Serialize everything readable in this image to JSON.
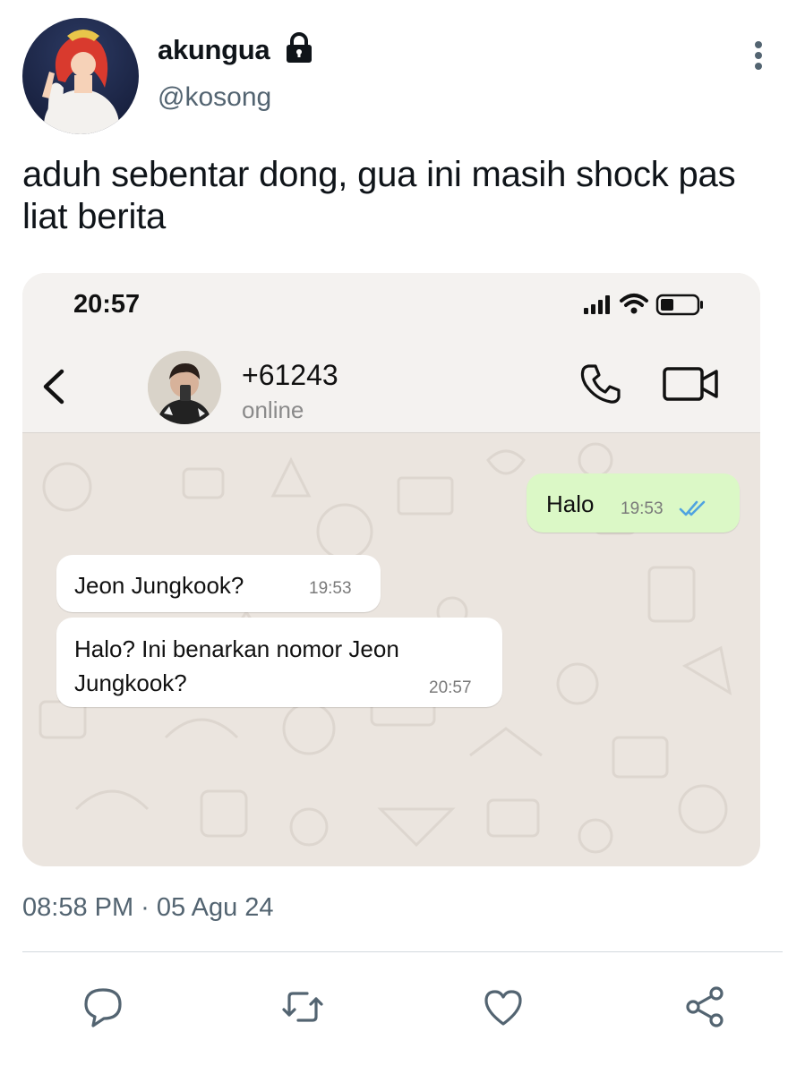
{
  "tweet": {
    "display_name": "akungua",
    "handle": "@kosong",
    "text": "aduh sebentar dong, gua ini masih shock pas liat berita",
    "timestamp": "08:58 PM · 05 Agu 24"
  },
  "chat": {
    "status_time": "20:57",
    "contact_number": "+61243",
    "contact_status": "online",
    "messages": [
      {
        "direction": "outgoing",
        "text": "Halo",
        "time": "19:53"
      },
      {
        "direction": "incoming",
        "text": "Jeon Jungkook?",
        "time": "19:53"
      },
      {
        "direction": "incoming",
        "text_lines": [
          "Halo? Ini benarkan nomor Jeon",
          "Jungkook?"
        ],
        "time": "20:57"
      }
    ]
  },
  "colors": {
    "outgoing_bubble": "#dbf8c6",
    "incoming_bubble": "#ffffff",
    "chat_background": "#ebe5df",
    "read_ticks": "#4fa3e0",
    "muted_text": "#536471"
  },
  "icons": [
    "lock-icon",
    "more-vertical-icon",
    "back-icon",
    "phone-call-icon",
    "video-call-icon",
    "signal-icon",
    "wifi-icon",
    "battery-icon",
    "double-check-icon",
    "reply-icon",
    "retweet-icon",
    "like-icon",
    "share-icon"
  ]
}
